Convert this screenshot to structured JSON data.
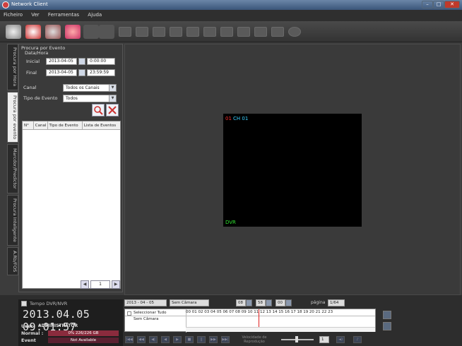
{
  "window": {
    "title": "Network Client"
  },
  "menu": [
    "Ficheiro",
    "Ver",
    "Ferramentas",
    "Ajuda"
  ],
  "vtabs": [
    "Procura por Hora",
    "Procura por evento",
    "Marcdor/Predictor",
    "Procura Inteligente",
    "A.Rb/FOS"
  ],
  "search": {
    "group_label": "Procura por Evento",
    "datetime_label": "Data/Hora",
    "start_label": "Inicial",
    "start_date": "2013-04-05",
    "start_time": "0:00:00",
    "end_label": "Final",
    "end_date": "2013-04-05",
    "end_time": "23:59:59",
    "channel_label": "Canal",
    "channel_value": "Todos os Canais",
    "event_type_label": "Tipo de Evento",
    "event_type_value": "Todos",
    "columns": [
      "N°",
      "Canal",
      "Tipo de Evento",
      "Lista de Eventos"
    ],
    "page": "1"
  },
  "video": {
    "channel_num": "01",
    "channel_name": "CH 01",
    "source_label": "DVR"
  },
  "status": {
    "time_label": "Tempo DVR/NVR",
    "clock": "2013.04.05 09:01:57",
    "user_label": "User",
    "user_value": "ADMINISTRATOR",
    "normal_label": "Normal :",
    "normal_value": "0% 226/226 GB",
    "normal_fraction": 0.0,
    "event_label": "Event",
    "event_value": "Not Available"
  },
  "timeline": {
    "date": "2013 - 04 - 05",
    "camera": "Sem Câmara",
    "hh": "08",
    "mm": "58",
    "ss": "00",
    "page_label": "página",
    "page_value": "1/64",
    "select_all": "Seleccionar Tudo",
    "camera_row": "Sem Câmara",
    "hours": "00 01 02 03 04 05 06 07 08 09 10 11 12 13 14 15 16 17 18 19 20 21 22 23",
    "speed_label": "Velocidade de Reprodução",
    "speed_value": "1"
  },
  "colors": {
    "channel_num": "#ff3030",
    "channel_name": "#3ad0ff",
    "dvr": "#30e030",
    "cursor": "#e02020",
    "bar": "#8a2b3d"
  }
}
